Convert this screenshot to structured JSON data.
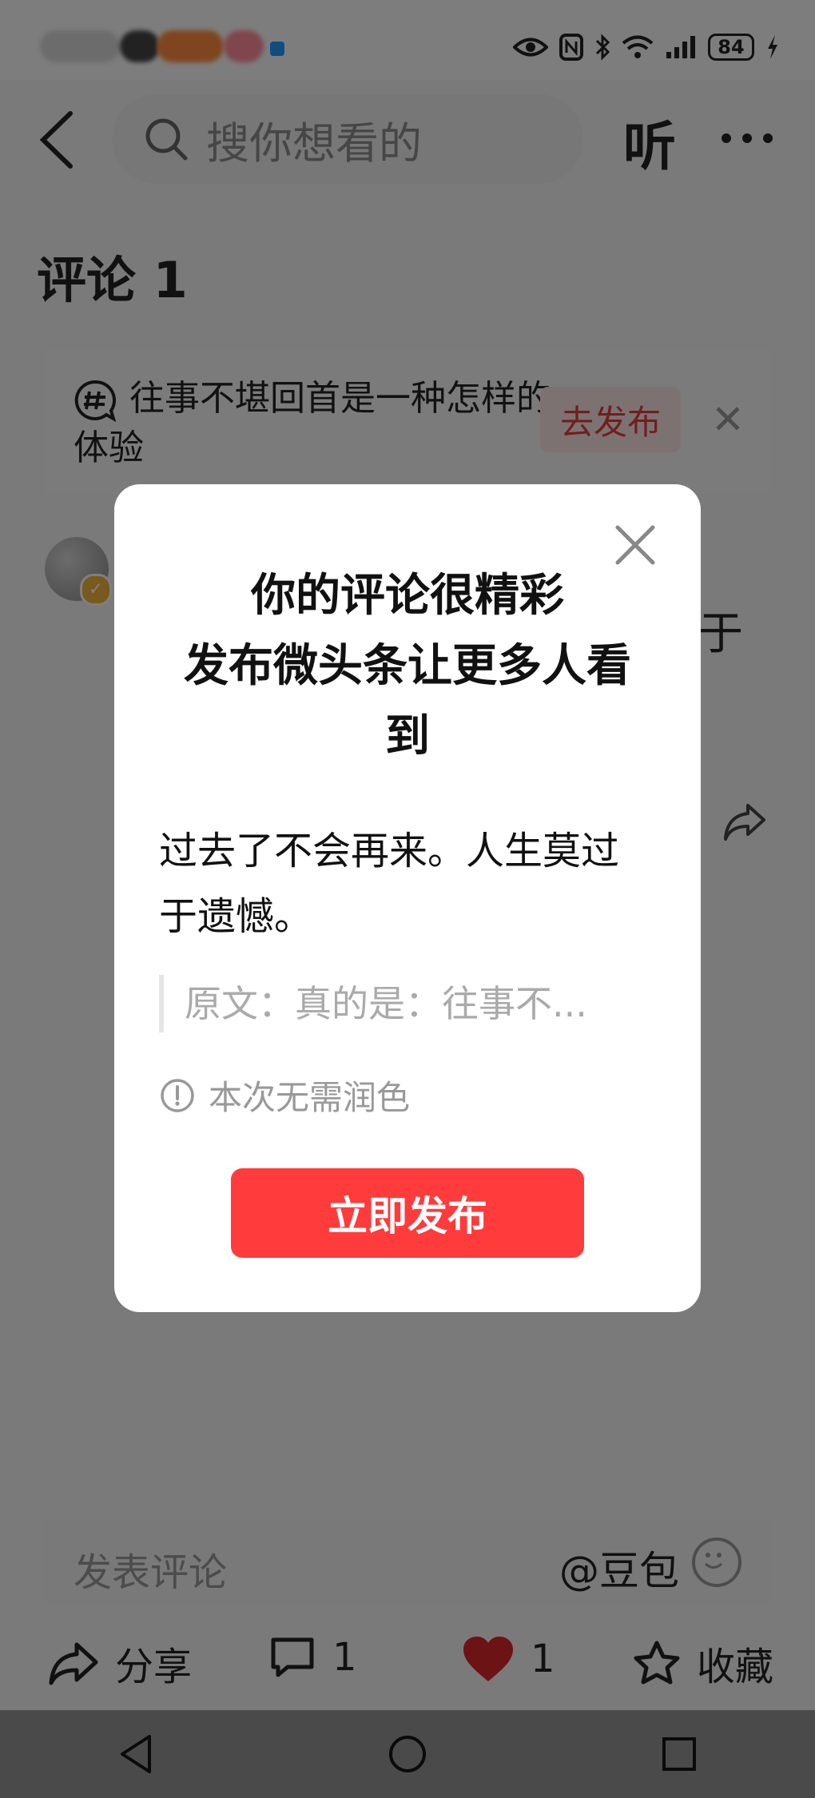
{
  "status_bar": {
    "battery": "84"
  },
  "nav": {
    "search_placeholder": "搜你想看的",
    "listen_label": "听"
  },
  "page": {
    "title": "评论 1",
    "topic_text": "往事不堪回首是一种怎样的体验",
    "topic_publish_label": "去发布",
    "background_fragment": "于"
  },
  "modal": {
    "title": "你的评论很精彩\n发布微头条让更多人看到",
    "body": "过去了不会再来。人生莫过于遗憾。",
    "quote": "原文：真的是：往事不...",
    "note": "本次无需润色",
    "publish_button": "立即发布"
  },
  "comment_bar": {
    "placeholder": "发表评论",
    "mention": "@豆包"
  },
  "actions": {
    "share_label": "分享",
    "comment_count": "1",
    "like_count": "1",
    "favorite_label": "收藏"
  },
  "colors": {
    "accent_red": "#ff3b3b",
    "heart_red": "#d9262a"
  }
}
